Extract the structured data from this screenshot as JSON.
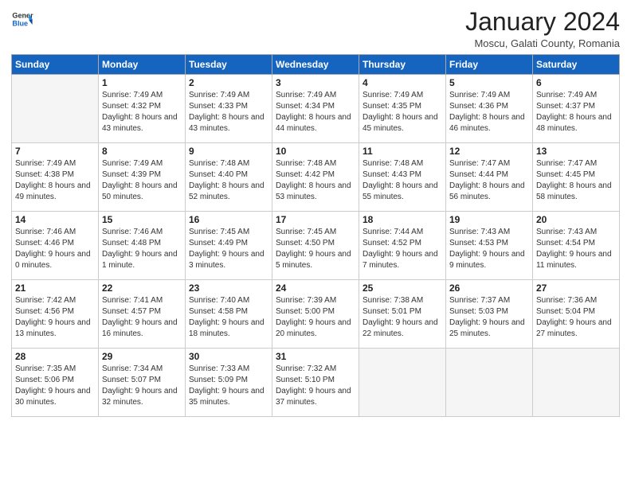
{
  "header": {
    "logo_general": "General",
    "logo_blue": "Blue",
    "month_title": "January 2024",
    "subtitle": "Moscu, Galati County, Romania"
  },
  "weekdays": [
    "Sunday",
    "Monday",
    "Tuesday",
    "Wednesday",
    "Thursday",
    "Friday",
    "Saturday"
  ],
  "weeks": [
    [
      {
        "day": "",
        "sunrise": "",
        "sunset": "",
        "daylight": ""
      },
      {
        "day": "1",
        "sunrise": "Sunrise: 7:49 AM",
        "sunset": "Sunset: 4:32 PM",
        "daylight": "Daylight: 8 hours and 43 minutes."
      },
      {
        "day": "2",
        "sunrise": "Sunrise: 7:49 AM",
        "sunset": "Sunset: 4:33 PM",
        "daylight": "Daylight: 8 hours and 43 minutes."
      },
      {
        "day": "3",
        "sunrise": "Sunrise: 7:49 AM",
        "sunset": "Sunset: 4:34 PM",
        "daylight": "Daylight: 8 hours and 44 minutes."
      },
      {
        "day": "4",
        "sunrise": "Sunrise: 7:49 AM",
        "sunset": "Sunset: 4:35 PM",
        "daylight": "Daylight: 8 hours and 45 minutes."
      },
      {
        "day": "5",
        "sunrise": "Sunrise: 7:49 AM",
        "sunset": "Sunset: 4:36 PM",
        "daylight": "Daylight: 8 hours and 46 minutes."
      },
      {
        "day": "6",
        "sunrise": "Sunrise: 7:49 AM",
        "sunset": "Sunset: 4:37 PM",
        "daylight": "Daylight: 8 hours and 48 minutes."
      }
    ],
    [
      {
        "day": "7",
        "sunrise": "Sunrise: 7:49 AM",
        "sunset": "Sunset: 4:38 PM",
        "daylight": "Daylight: 8 hours and 49 minutes."
      },
      {
        "day": "8",
        "sunrise": "Sunrise: 7:49 AM",
        "sunset": "Sunset: 4:39 PM",
        "daylight": "Daylight: 8 hours and 50 minutes."
      },
      {
        "day": "9",
        "sunrise": "Sunrise: 7:48 AM",
        "sunset": "Sunset: 4:40 PM",
        "daylight": "Daylight: 8 hours and 52 minutes."
      },
      {
        "day": "10",
        "sunrise": "Sunrise: 7:48 AM",
        "sunset": "Sunset: 4:42 PM",
        "daylight": "Daylight: 8 hours and 53 minutes."
      },
      {
        "day": "11",
        "sunrise": "Sunrise: 7:48 AM",
        "sunset": "Sunset: 4:43 PM",
        "daylight": "Daylight: 8 hours and 55 minutes."
      },
      {
        "day": "12",
        "sunrise": "Sunrise: 7:47 AM",
        "sunset": "Sunset: 4:44 PM",
        "daylight": "Daylight: 8 hours and 56 minutes."
      },
      {
        "day": "13",
        "sunrise": "Sunrise: 7:47 AM",
        "sunset": "Sunset: 4:45 PM",
        "daylight": "Daylight: 8 hours and 58 minutes."
      }
    ],
    [
      {
        "day": "14",
        "sunrise": "Sunrise: 7:46 AM",
        "sunset": "Sunset: 4:46 PM",
        "daylight": "Daylight: 9 hours and 0 minutes."
      },
      {
        "day": "15",
        "sunrise": "Sunrise: 7:46 AM",
        "sunset": "Sunset: 4:48 PM",
        "daylight": "Daylight: 9 hours and 1 minute."
      },
      {
        "day": "16",
        "sunrise": "Sunrise: 7:45 AM",
        "sunset": "Sunset: 4:49 PM",
        "daylight": "Daylight: 9 hours and 3 minutes."
      },
      {
        "day": "17",
        "sunrise": "Sunrise: 7:45 AM",
        "sunset": "Sunset: 4:50 PM",
        "daylight": "Daylight: 9 hours and 5 minutes."
      },
      {
        "day": "18",
        "sunrise": "Sunrise: 7:44 AM",
        "sunset": "Sunset: 4:52 PM",
        "daylight": "Daylight: 9 hours and 7 minutes."
      },
      {
        "day": "19",
        "sunrise": "Sunrise: 7:43 AM",
        "sunset": "Sunset: 4:53 PM",
        "daylight": "Daylight: 9 hours and 9 minutes."
      },
      {
        "day": "20",
        "sunrise": "Sunrise: 7:43 AM",
        "sunset": "Sunset: 4:54 PM",
        "daylight": "Daylight: 9 hours and 11 minutes."
      }
    ],
    [
      {
        "day": "21",
        "sunrise": "Sunrise: 7:42 AM",
        "sunset": "Sunset: 4:56 PM",
        "daylight": "Daylight: 9 hours and 13 minutes."
      },
      {
        "day": "22",
        "sunrise": "Sunrise: 7:41 AM",
        "sunset": "Sunset: 4:57 PM",
        "daylight": "Daylight: 9 hours and 16 minutes."
      },
      {
        "day": "23",
        "sunrise": "Sunrise: 7:40 AM",
        "sunset": "Sunset: 4:58 PM",
        "daylight": "Daylight: 9 hours and 18 minutes."
      },
      {
        "day": "24",
        "sunrise": "Sunrise: 7:39 AM",
        "sunset": "Sunset: 5:00 PM",
        "daylight": "Daylight: 9 hours and 20 minutes."
      },
      {
        "day": "25",
        "sunrise": "Sunrise: 7:38 AM",
        "sunset": "Sunset: 5:01 PM",
        "daylight": "Daylight: 9 hours and 22 minutes."
      },
      {
        "day": "26",
        "sunrise": "Sunrise: 7:37 AM",
        "sunset": "Sunset: 5:03 PM",
        "daylight": "Daylight: 9 hours and 25 minutes."
      },
      {
        "day": "27",
        "sunrise": "Sunrise: 7:36 AM",
        "sunset": "Sunset: 5:04 PM",
        "daylight": "Daylight: 9 hours and 27 minutes."
      }
    ],
    [
      {
        "day": "28",
        "sunrise": "Sunrise: 7:35 AM",
        "sunset": "Sunset: 5:06 PM",
        "daylight": "Daylight: 9 hours and 30 minutes."
      },
      {
        "day": "29",
        "sunrise": "Sunrise: 7:34 AM",
        "sunset": "Sunset: 5:07 PM",
        "daylight": "Daylight: 9 hours and 32 minutes."
      },
      {
        "day": "30",
        "sunrise": "Sunrise: 7:33 AM",
        "sunset": "Sunset: 5:09 PM",
        "daylight": "Daylight: 9 hours and 35 minutes."
      },
      {
        "day": "31",
        "sunrise": "Sunrise: 7:32 AM",
        "sunset": "Sunset: 5:10 PM",
        "daylight": "Daylight: 9 hours and 37 minutes."
      },
      {
        "day": "",
        "sunrise": "",
        "sunset": "",
        "daylight": ""
      },
      {
        "day": "",
        "sunrise": "",
        "sunset": "",
        "daylight": ""
      },
      {
        "day": "",
        "sunrise": "",
        "sunset": "",
        "daylight": ""
      }
    ]
  ]
}
